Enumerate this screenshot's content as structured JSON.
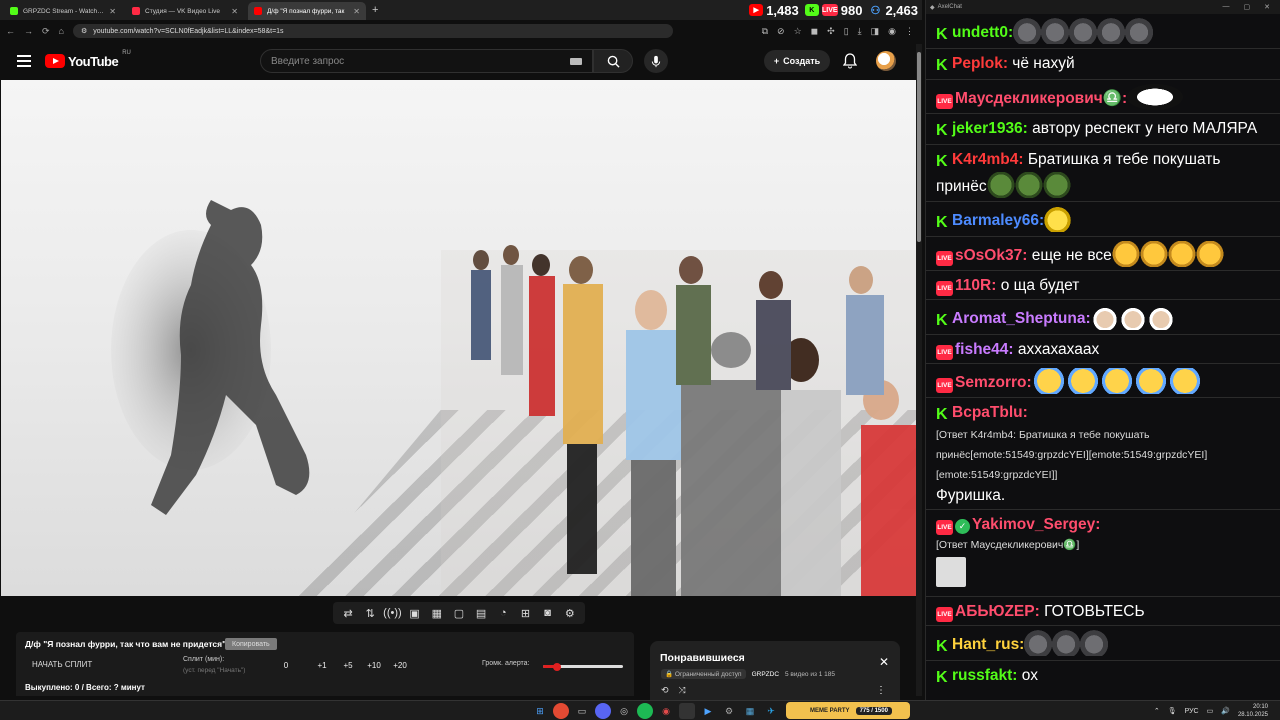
{
  "browser": {
    "tabs": [
      {
        "title": "GRPZDC Stream - Watch Live o",
        "color": "#53fc18"
      },
      {
        "title": "Студия — VK Видео Live",
        "color": "#ff2a44"
      },
      {
        "title": "Д/ф \"Я познал фурри, так",
        "color": "#ff0000",
        "active": true
      }
    ],
    "new_tab": "+",
    "url": "youtube.com/watch?v=SCLN0fEadjk&list=LL&index=58&t=1s"
  },
  "stats": {
    "youtube_viewers": "1,483",
    "kick_label": "K",
    "vk_viewers": "980",
    "vk_label": "LIVE",
    "total_viewers": "2,463"
  },
  "youtube": {
    "logo_text": "YouTube",
    "region": "RU",
    "search_placeholder": "Введите запрос",
    "create_label": "Создать"
  },
  "player_controls": [
    "⇄",
    "⇅",
    "((•))",
    "▣",
    "▦",
    "▢",
    "▤",
    "◔",
    "⊞",
    "◙",
    "⚙"
  ],
  "alert_panel": {
    "title": "Д/ф \"Я познал фурри, так что вам не придется\"",
    "copy_label": "Копировать",
    "start_split": "НАЧАТЬ СПЛИТ",
    "split_label": "Сплит (мин):",
    "split_hint": "(уст. перед \"Начать\")",
    "split_values": [
      "0",
      "+1",
      "+5",
      "+10",
      "+20"
    ],
    "volume_label": "Громк. алерта:",
    "volume_level": 0.18,
    "bought": "Выкуплено: 0 / Всего: ? минут"
  },
  "liked_panel": {
    "title": "Понравившиеся",
    "access": "Ограниченный доступ",
    "channel": "GRPZDC",
    "count": "5 видео из 1 185",
    "close": "✕"
  },
  "chat": {
    "window_title": "AxelChat",
    "messages": [
      {
        "platform": "kick",
        "nick": "undett0:",
        "color": "#53fc18",
        "emotes": [
          "rat",
          "rat",
          "rat",
          "rat",
          "rat"
        ]
      },
      {
        "platform": "kick",
        "nick": "Peplok:",
        "color": "#ff3b3b",
        "text": "чё нахуй"
      },
      {
        "platform": "vk",
        "nick": "Маусдекликерович♎:",
        "color": "#ff4d6d",
        "emotes": [
          "cat"
        ]
      },
      {
        "platform": "kick",
        "nick": "jeker1936:",
        "color": "#53fc18",
        "text": "автору респект у него МАЛЯРА"
      },
      {
        "platform": "kick",
        "nick": "K4r4mb4:",
        "color": "#ff3b3b",
        "text": "Братишка я тебе покушать принёс",
        "emotes": [
          "pepe",
          "pepe",
          "pepe"
        ]
      },
      {
        "platform": "kick",
        "nick": "Barmaley66:",
        "color": "#4d8bff",
        "emotes": [
          "duck"
        ]
      },
      {
        "platform": "vk",
        "nick": "sOsOk37:",
        "color": "#ff4d6d",
        "text": "еще не все",
        "emotes": [
          "think",
          "think",
          "think",
          "think"
        ]
      },
      {
        "platform": "vk",
        "nick": "110R:",
        "color": "#ff4d6d",
        "text": "о ща будет"
      },
      {
        "platform": "kick",
        "nick": "Aromat_Sheptuna:",
        "color": "#c97bff",
        "emotes": [
          "chef",
          "chef",
          "chef"
        ]
      },
      {
        "platform": "vk",
        "nick": "fishe44:",
        "color": "#c97bff",
        "text": "аххахахаах"
      },
      {
        "platform": "vk",
        "nick": "Semzorro:",
        "color": "#ff4d6d",
        "emotes": [
          "cry",
          "cry",
          "cry",
          "cry",
          "cry"
        ]
      },
      {
        "platform": "kick",
        "nick": "BcpaTblu:",
        "color": "#ff4d6d",
        "reply": "[Ответ K4r4mb4: Братишка я тебе покушать принёс[emote:51549:grpzdcYEI][emote:51549:grpzdcYEI][emote:51549:grpzdcYEI]]",
        "text": "Фуришка."
      },
      {
        "platform": "vk",
        "verified": true,
        "nick": "Yakimov_Sergey:",
        "color": "#ff4d6d",
        "reply": "[Ответ Маусдекликерович♎]",
        "image": true
      },
      {
        "platform": "vk",
        "nick": "АБЬЮZEP:",
        "color": "#ff4d6d",
        "text": "ГОТОВЬТЕСЬ"
      },
      {
        "platform": "kick",
        "nick": "Hant_rus:",
        "color": "#ffd23d",
        "emotes": [
          "rat",
          "rat",
          "rat"
        ]
      },
      {
        "platform": "kick",
        "nick": "russfakt:",
        "color": "#53fc18",
        "text": "ох"
      }
    ]
  },
  "taskbar": {
    "meme_label": "MEME PARTY",
    "meme_counter": "775 / 1500",
    "lang": "РУС",
    "time": "20:10",
    "date": "28.10.2025"
  }
}
